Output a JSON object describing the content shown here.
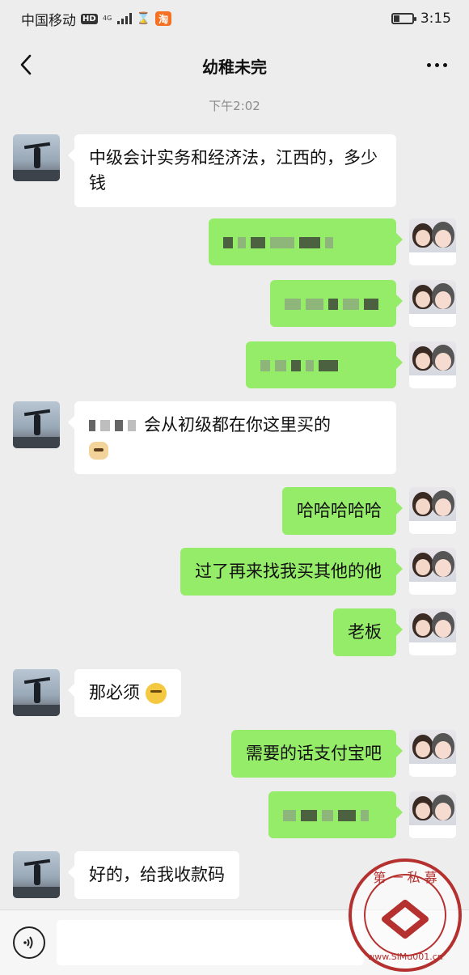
{
  "status_bar": {
    "carrier": "中国移动",
    "hd": "HD",
    "net": "4G",
    "taobao": "淘",
    "time": "3:15",
    "battery_level": 0.3
  },
  "nav": {
    "title": "幼稚未完",
    "back_icon": "chevron-left-icon",
    "more_icon": "more-dots-icon"
  },
  "chat": {
    "timestamp": "下午2:02",
    "messages": [
      {
        "side": "left",
        "text": "中级会计实务和经济法，江西的，多少钱"
      },
      {
        "side": "right",
        "redacted": true
      },
      {
        "side": "right",
        "redacted": true
      },
      {
        "side": "right",
        "redacted": true
      },
      {
        "side": "left",
        "text": "会从初级都在你这里买的"
      },
      {
        "side": "right",
        "text": "哈哈哈哈哈"
      },
      {
        "side": "right",
        "text": "过了再来找我买其他的他"
      },
      {
        "side": "right",
        "text": "老板"
      },
      {
        "side": "left",
        "text": "那必须"
      },
      {
        "side": "right",
        "text": "需要的话支付宝吧"
      },
      {
        "side": "right",
        "redacted": true
      },
      {
        "side": "left",
        "text": "好的，给我收款码"
      }
    ]
  },
  "input_bar": {
    "voice_icon": "voice-icon",
    "placeholder": ""
  },
  "watermark": {
    "text": "第一私募",
    "url": "www.SiMu001.cn"
  }
}
